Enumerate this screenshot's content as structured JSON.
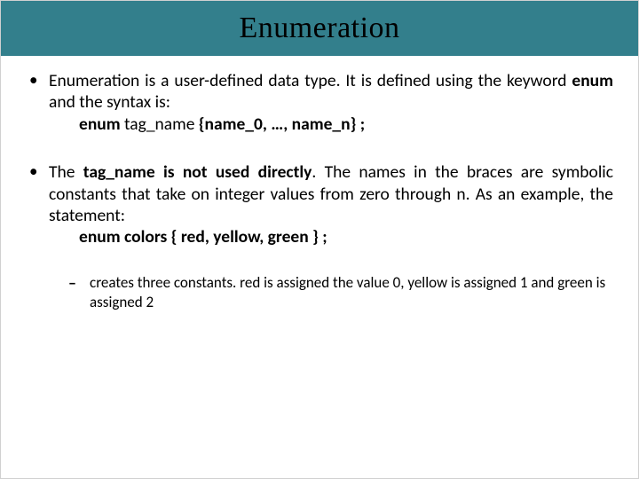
{
  "title": "Enumeration",
  "bullets": {
    "b1": {
      "p1a": "Enumeration is a user-defined data type.  It is defined using the keyword ",
      "enum1": "enum",
      "p1b": " and the syntax is:",
      "enum2": "enum",
      "tag": " tag_name ",
      "braces": "{name_0, …, name_n} ;"
    },
    "b2": {
      "t1": "The ",
      "bold1": "tag_name is not used directly",
      "t2": ". The names in the braces are symbolic constants that take on integer values from zero through n. As an example, the statement:",
      "example": "enum colors { red, yellow, green } ;",
      "sub": "creates three constants. red is assigned the value 0, yellow is assigned 1 and green is assigned 2"
    }
  }
}
